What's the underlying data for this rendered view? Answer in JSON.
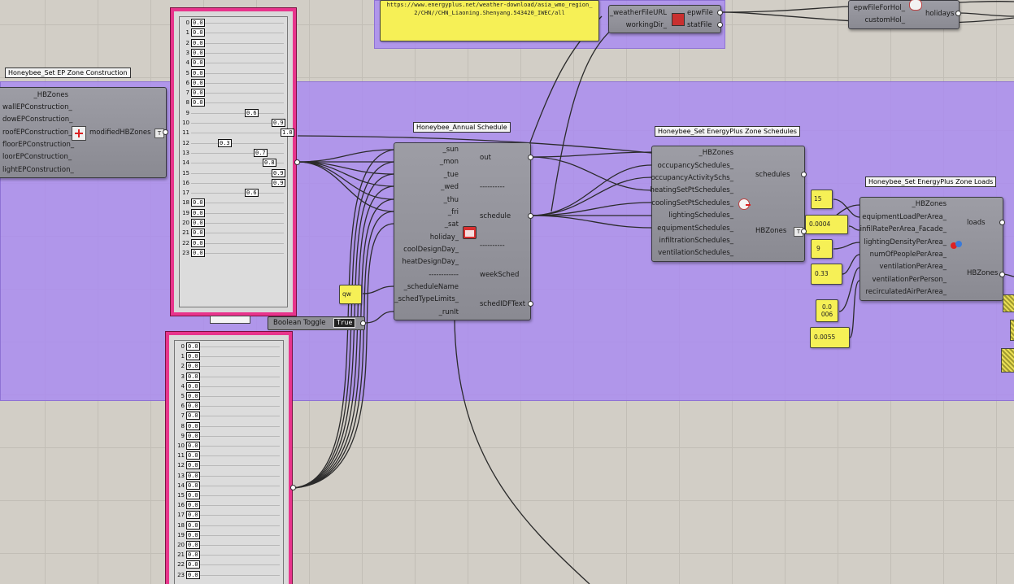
{
  "url_panel": {
    "text": "https://www.energyplus.net/weather-download/asia_wmo_region_2/CHN//CHN_Liaoning.Shenyang.543420_IWEC/all"
  },
  "weather_comp": {
    "inputs": [
      "_weatherFileURL",
      "workingDir_"
    ],
    "outputs": [
      "epwFile",
      "statFile"
    ]
  },
  "holiday_comp": {
    "inputs": [
      "epwFileForHol_",
      "customHol_"
    ],
    "outputs": [
      "holidays"
    ]
  },
  "construction": {
    "title": "Honeybee_Set EP Zone Construction",
    "inputs": [
      "_HBZones",
      "wallEPConstruction_",
      "dowEPConstruction_",
      "roofEPConstruction_",
      "floorEPConstruction_",
      "loorEPConstruction_",
      "lightEPConstruction_"
    ],
    "outputs": [
      "modifiedHBZones"
    ],
    "badge": "T"
  },
  "graph_top": {
    "indices": [
      "0",
      "1",
      "2",
      "3",
      "4",
      "5",
      "6",
      "7",
      "8",
      "9",
      "10",
      "11",
      "12",
      "13",
      "14",
      "15",
      "16",
      "17",
      "18",
      "19",
      "20",
      "21",
      "22",
      "23"
    ],
    "values": [
      "0.0",
      "0.0",
      "0.0",
      "0.0",
      "0.0",
      "0.0",
      "0.0",
      "0.0",
      "0.0",
      "0.6",
      "0.9",
      "1.0",
      "0.3",
      "0.7",
      "0.8",
      "0.9",
      "0.9",
      "0.6",
      "0.0",
      "0.0",
      "0.0",
      "0.0",
      "0.0",
      "0.0"
    ]
  },
  "graph_bottom": {
    "indices": [
      "0",
      "1",
      "2",
      "3",
      "4",
      "5",
      "6",
      "7",
      "8",
      "9",
      "10",
      "11",
      "12",
      "13",
      "14",
      "15",
      "16",
      "17",
      "18",
      "19",
      "20",
      "21",
      "22",
      "23"
    ],
    "values": [
      "0.0",
      "0.0",
      "0.0",
      "0.0",
      "0.0",
      "0.0",
      "0.0",
      "0.0",
      "0.0",
      "0.0",
      "0.0",
      "0.0",
      "0.0",
      "0.0",
      "0.0",
      "0.0",
      "0.0",
      "0.0",
      "0.0",
      "0.0",
      "0.0",
      "0.0",
      "0.0",
      "0.0"
    ]
  },
  "annual": {
    "title": "Honeybee_Annual Schedule",
    "inputs": [
      "_sun",
      "_mon",
      "_tue",
      "_wed",
      "_thu",
      "_fri",
      "_sat",
      "holiday_",
      "coolDesignDay_",
      "heatDesignDay_",
      "------------",
      "_scheduleName",
      "_schedTypeLimits_",
      "_runIt"
    ],
    "outputs": [
      "out",
      "----------",
      "schedule",
      "----------",
      "weekSched",
      "schedIDFText"
    ]
  },
  "panel_qw": "qw",
  "toggle": {
    "label": "Boolean Toggle",
    "value": "True"
  },
  "zone_sched": {
    "title": "Honeybee_Set EnergyPlus Zone Schedules",
    "inputs": [
      "_HBZones",
      "occupancySchedules_",
      "occupancyActivitySchs_",
      "heatingSetPtSchedules_",
      "coolingSetPtSchedules_",
      "lightingSchedules_",
      "equipmentSchedules_",
      "infiltrationSchedules_",
      "ventilationSchedules_"
    ],
    "outputs": [
      "schedules",
      "HBZones"
    ],
    "badge": "T"
  },
  "zone_loads": {
    "title": "Honeybee_Set EnergyPlus Zone Loads",
    "inputs": [
      "_HBZones",
      "equipmentLoadPerArea_",
      "infilRatePerArea_Facade_",
      "lightingDensityPerArea_",
      "numOfPeoplePerArea_",
      "ventilationPerArea_",
      "ventilationPerPerson_",
      "recirculatedAirPerArea_"
    ],
    "outputs": [
      "loads",
      "HBZones"
    ]
  },
  "load_values": [
    "15",
    "0.0004",
    "9",
    "0.33",
    "0.0\n006",
    "0.0055"
  ],
  "colors": {
    "canvas": "#d2cec6",
    "group": "#aa8cf0",
    "graph_border": "#e8348c",
    "panel": "#f6f056"
  }
}
